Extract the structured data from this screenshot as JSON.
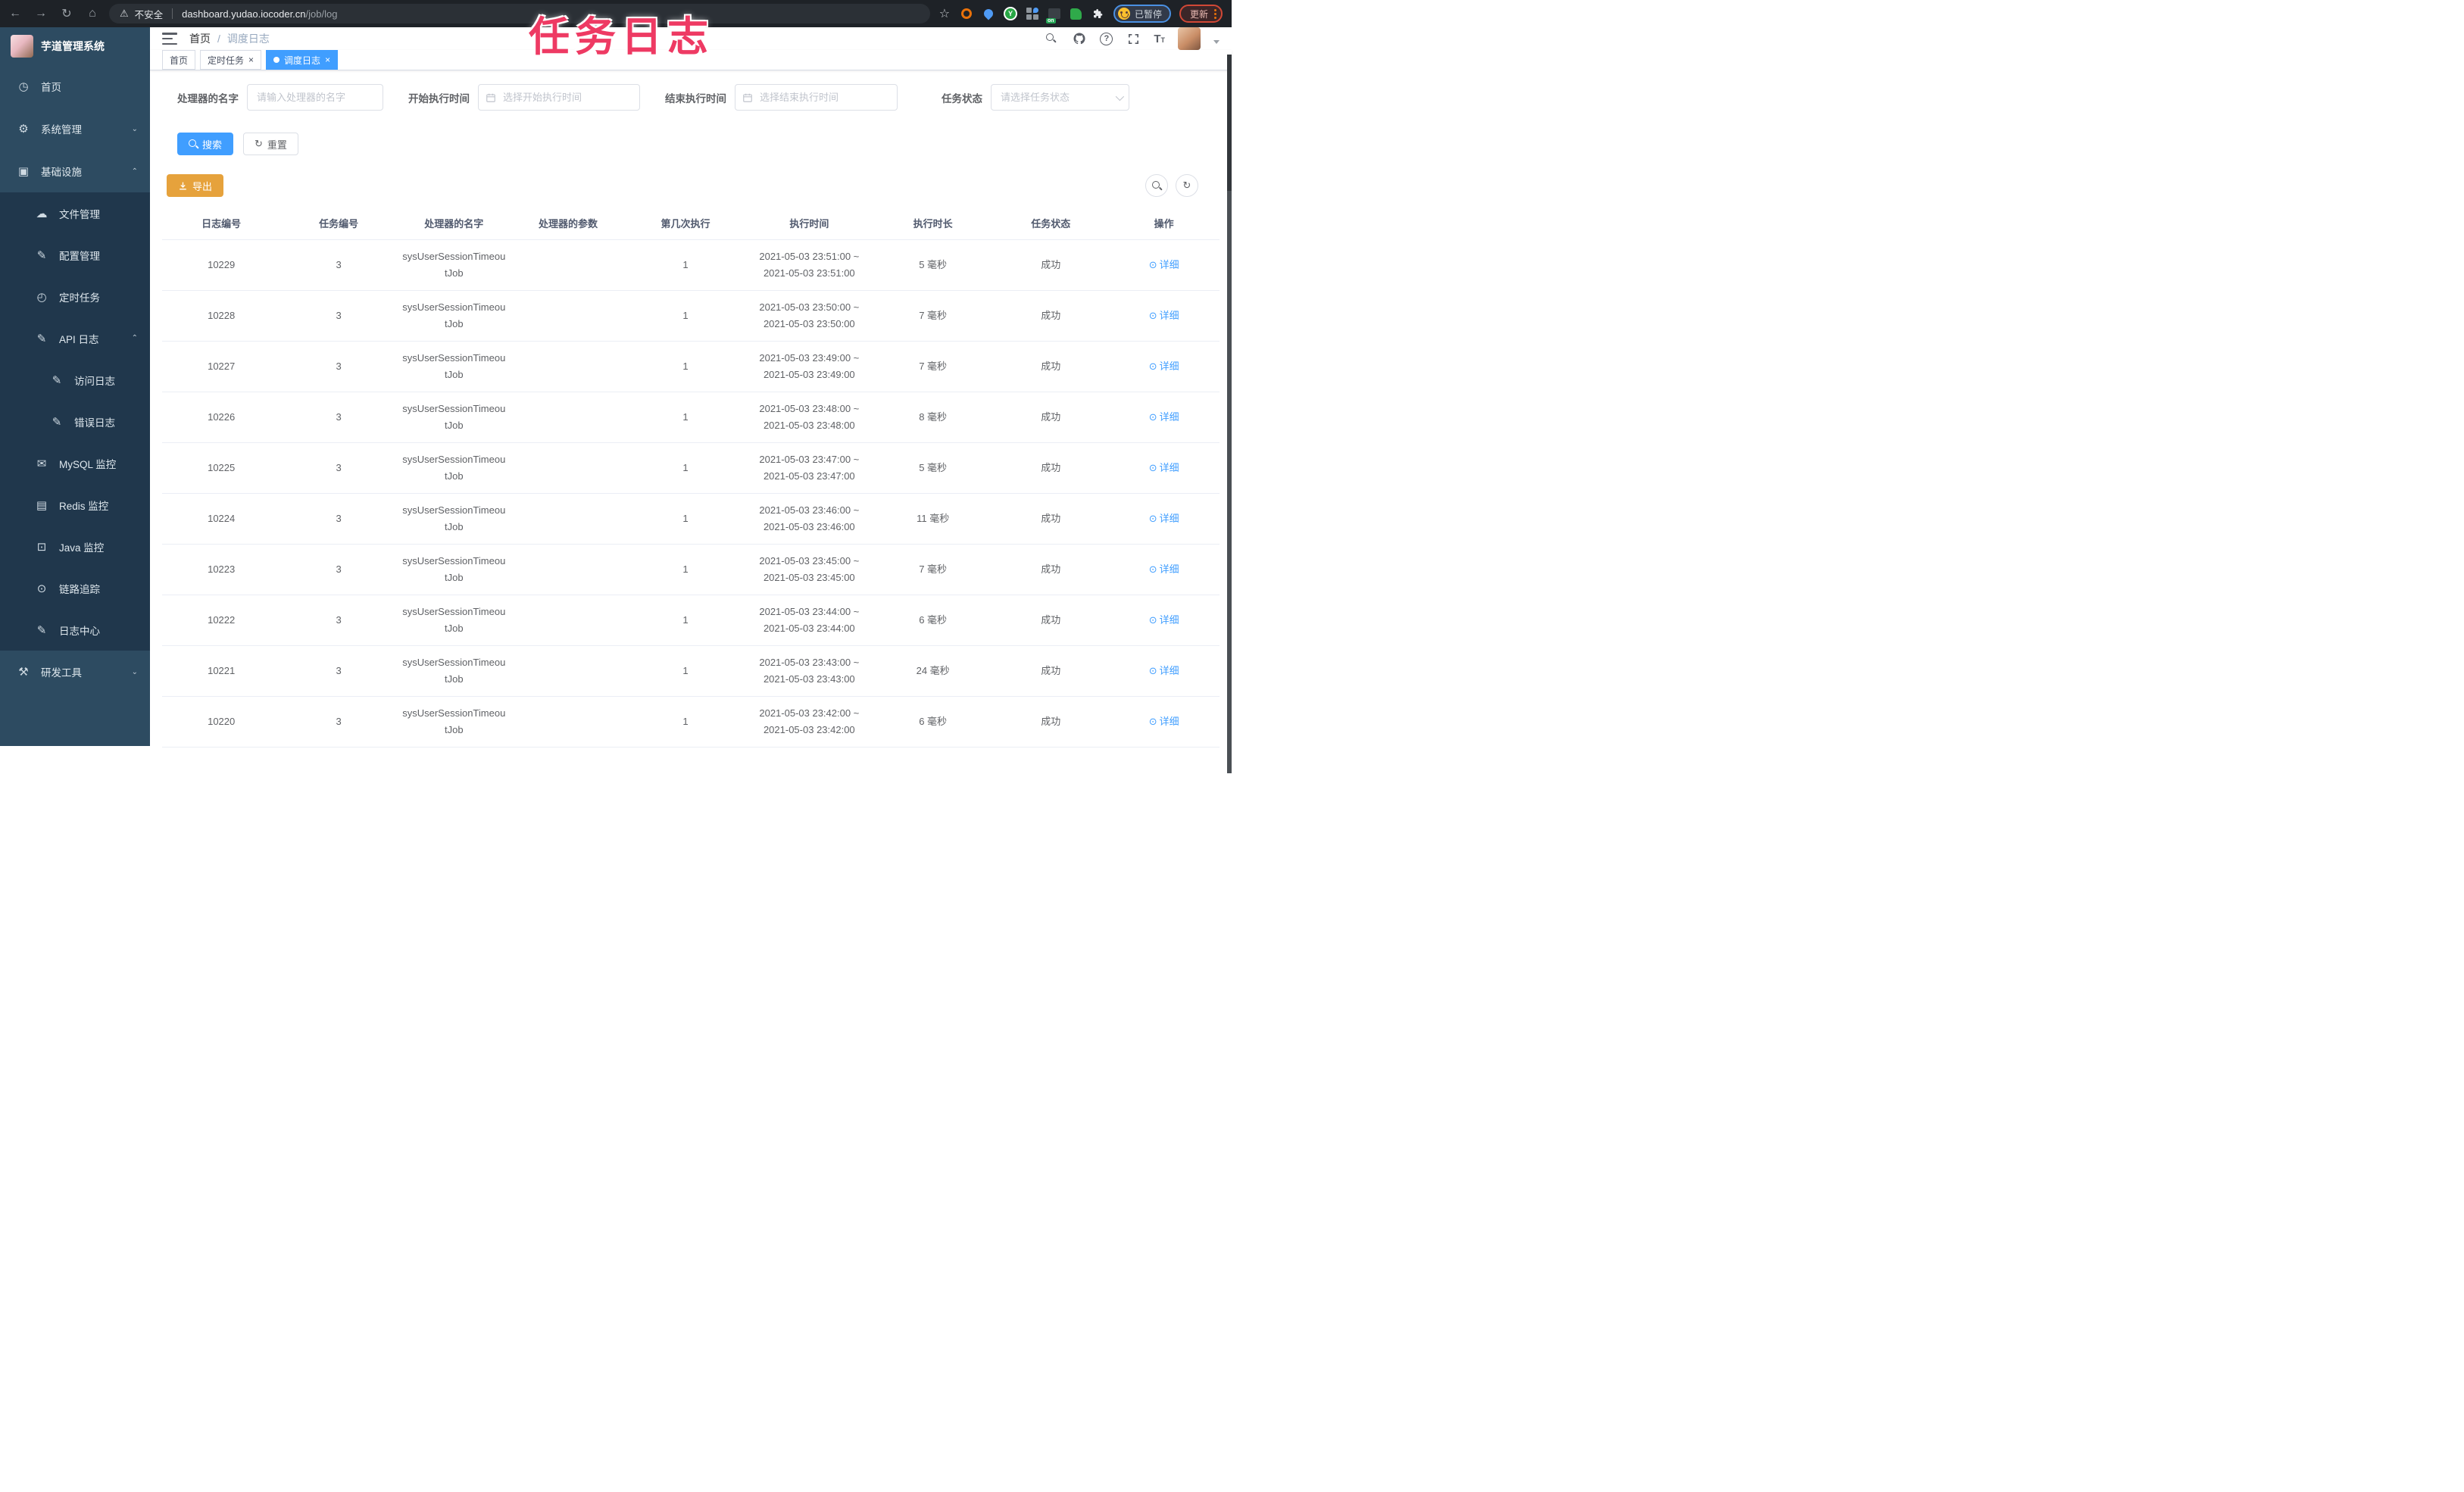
{
  "colors": {
    "accent": "#409eff",
    "warning": "#e6a23c",
    "overlay_pink": "#ee3a63",
    "sidebar_bg": "#2d4b61",
    "submenu_bg": "#20374c"
  },
  "overlay": {
    "title": "任务日志"
  },
  "browser": {
    "security_label": "不安全",
    "url_domain": "dashboard.yudao.iocoder.cn",
    "url_path": "/job/log",
    "paused_badge": "已暂停",
    "update_button": "更新"
  },
  "app": {
    "title": "芋道管理系统",
    "breadcrumb": {
      "home": "首页",
      "separator": "/",
      "current": "调度日志"
    }
  },
  "tabs": [
    {
      "label": "首页",
      "active": false,
      "closable": false
    },
    {
      "label": "定时任务",
      "active": false,
      "closable": true
    },
    {
      "label": "调度日志",
      "active": true,
      "closable": true
    }
  ],
  "sidebar": {
    "items": [
      {
        "label": "首页",
        "icon": "dashboard-icon",
        "level": 1,
        "chevron": ""
      },
      {
        "label": "系统管理",
        "icon": "gear-icon",
        "level": 1,
        "chevron": "down"
      },
      {
        "label": "基础设施",
        "icon": "monitor-icon",
        "level": 1,
        "chevron": "up"
      },
      {
        "label": "文件管理",
        "icon": "cloud-upload-icon",
        "level": 2,
        "chevron": ""
      },
      {
        "label": "配置管理",
        "icon": "edit-icon",
        "level": 2,
        "chevron": ""
      },
      {
        "label": "定时任务",
        "icon": "timer-icon",
        "level": 2,
        "chevron": ""
      },
      {
        "label": "API 日志",
        "icon": "log-edit-icon",
        "level": 2,
        "chevron": "up"
      },
      {
        "label": "访问日志",
        "icon": "log-edit-icon",
        "level": 3,
        "chevron": ""
      },
      {
        "label": "错误日志",
        "icon": "log-edit-icon",
        "level": 3,
        "chevron": ""
      },
      {
        "label": "MySQL 监控",
        "icon": "mail-icon",
        "level": 2,
        "chevron": ""
      },
      {
        "label": "Redis 监控",
        "icon": "layers-icon",
        "level": 2,
        "chevron": ""
      },
      {
        "label": "Java 监控",
        "icon": "java-monitor-icon",
        "level": 2,
        "chevron": ""
      },
      {
        "label": "链路追踪",
        "icon": "eye-icon",
        "level": 2,
        "chevron": ""
      },
      {
        "label": "日志中心",
        "icon": "log-edit-icon",
        "level": 2,
        "chevron": ""
      },
      {
        "label": "研发工具",
        "icon": "toolbox-icon",
        "level": 1,
        "chevron": "down"
      }
    ]
  },
  "filters": {
    "handler_name": {
      "label": "处理器的名字",
      "placeholder": "请输入处理器的名字"
    },
    "begin_time": {
      "label": "开始执行时间",
      "placeholder": "选择开始执行时间"
    },
    "end_time": {
      "label": "结束执行时间",
      "placeholder": "选择结束执行时间"
    },
    "status": {
      "label": "任务状态",
      "placeholder": "请选择任务状态"
    }
  },
  "actions": {
    "search": "搜索",
    "reset": "重置",
    "export": "导出"
  },
  "table": {
    "columns": [
      "日志编号",
      "任务编号",
      "处理器的名字",
      "处理器的参数",
      "第几次执行",
      "执行时间",
      "执行时长",
      "任务状态",
      "操作"
    ],
    "detail_label": "详细",
    "rows": [
      {
        "id": "10229",
        "job_id": "3",
        "handler": "sysUserSessionTimeoutJob",
        "param": "",
        "index": "1",
        "time_start": "2021-05-03 23:51:00",
        "time_end": "2021-05-03 23:51:00",
        "duration": "5 毫秒",
        "status": "成功"
      },
      {
        "id": "10228",
        "job_id": "3",
        "handler": "sysUserSessionTimeoutJob",
        "param": "",
        "index": "1",
        "time_start": "2021-05-03 23:50:00",
        "time_end": "2021-05-03 23:50:00",
        "duration": "7 毫秒",
        "status": "成功"
      },
      {
        "id": "10227",
        "job_id": "3",
        "handler": "sysUserSessionTimeoutJob",
        "param": "",
        "index": "1",
        "time_start": "2021-05-03 23:49:00",
        "time_end": "2021-05-03 23:49:00",
        "duration": "7 毫秒",
        "status": "成功"
      },
      {
        "id": "10226",
        "job_id": "3",
        "handler": "sysUserSessionTimeoutJob",
        "param": "",
        "index": "1",
        "time_start": "2021-05-03 23:48:00",
        "time_end": "2021-05-03 23:48:00",
        "duration": "8 毫秒",
        "status": "成功"
      },
      {
        "id": "10225",
        "job_id": "3",
        "handler": "sysUserSessionTimeoutJob",
        "param": "",
        "index": "1",
        "time_start": "2021-05-03 23:47:00",
        "time_end": "2021-05-03 23:47:00",
        "duration": "5 毫秒",
        "status": "成功"
      },
      {
        "id": "10224",
        "job_id": "3",
        "handler": "sysUserSessionTimeoutJob",
        "param": "",
        "index": "1",
        "time_start": "2021-05-03 23:46:00",
        "time_end": "2021-05-03 23:46:00",
        "duration": "11 毫秒",
        "status": "成功"
      },
      {
        "id": "10223",
        "job_id": "3",
        "handler": "sysUserSessionTimeoutJob",
        "param": "",
        "index": "1",
        "time_start": "2021-05-03 23:45:00",
        "time_end": "2021-05-03 23:45:00",
        "duration": "7 毫秒",
        "status": "成功"
      },
      {
        "id": "10222",
        "job_id": "3",
        "handler": "sysUserSessionTimeoutJob",
        "param": "",
        "index": "1",
        "time_start": "2021-05-03 23:44:00",
        "time_end": "2021-05-03 23:44:00",
        "duration": "6 毫秒",
        "status": "成功"
      },
      {
        "id": "10221",
        "job_id": "3",
        "handler": "sysUserSessionTimeoutJob",
        "param": "",
        "index": "1",
        "time_start": "2021-05-03 23:43:00",
        "time_end": "2021-05-03 23:43:00",
        "duration": "24 毫秒",
        "status": "成功"
      },
      {
        "id": "10220",
        "job_id": "3",
        "handler": "sysUserSessionTimeoutJob",
        "param": "",
        "index": "1",
        "time_start": "2021-05-03 23:42:00",
        "time_end": "2021-05-03 23:42:00",
        "duration": "6 毫秒",
        "status": "成功"
      }
    ]
  }
}
